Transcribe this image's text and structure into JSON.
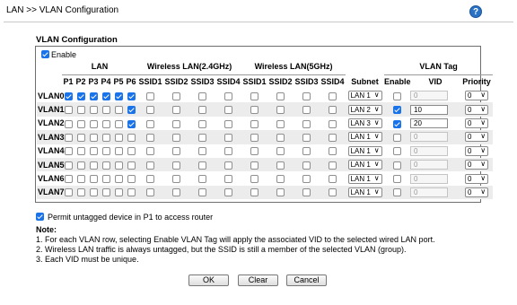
{
  "header": {
    "title": "LAN >> VLAN Configuration",
    "help_icon": "?"
  },
  "section_title": "VLAN Configuration",
  "enable": {
    "label": "Enable",
    "checked": true
  },
  "groups": {
    "lan": "LAN",
    "wlan24": "Wireless LAN(2.4GHz)",
    "wlan5": "Wireless LAN(5GHz)",
    "vlan_tag": "VLAN Tag"
  },
  "columns": {
    "lan": [
      "P1",
      "P2",
      "P3",
      "P4",
      "P5",
      "P6"
    ],
    "wlan24": [
      "SSID1",
      "SSID2",
      "SSID3",
      "SSID4"
    ],
    "wlan5": [
      "SSID1",
      "SSID2",
      "SSID3",
      "SSID4"
    ],
    "subnet": "Subnet",
    "enable": "Enable",
    "vid": "VID",
    "priority": "Priority"
  },
  "rows": [
    {
      "name": "VLAN0",
      "lan": [
        true,
        true,
        true,
        true,
        true,
        true
      ],
      "wlan24": [
        false,
        false,
        false,
        false
      ],
      "wlan5": [
        false,
        false,
        false,
        false
      ],
      "subnet": "LAN 1",
      "tag_enable": false,
      "vid": "0",
      "priority": "0"
    },
    {
      "name": "VLAN1",
      "lan": [
        false,
        false,
        false,
        false,
        false,
        true
      ],
      "wlan24": [
        false,
        false,
        false,
        false
      ],
      "wlan5": [
        false,
        false,
        false,
        false
      ],
      "subnet": "LAN 2",
      "tag_enable": true,
      "vid": "10",
      "priority": "0"
    },
    {
      "name": "VLAN2",
      "lan": [
        false,
        false,
        false,
        false,
        false,
        true
      ],
      "wlan24": [
        false,
        false,
        false,
        false
      ],
      "wlan5": [
        false,
        false,
        false,
        false
      ],
      "subnet": "LAN 3",
      "tag_enable": true,
      "vid": "20",
      "priority": "0"
    },
    {
      "name": "VLAN3",
      "lan": [
        false,
        false,
        false,
        false,
        false,
        false
      ],
      "wlan24": [
        false,
        false,
        false,
        false
      ],
      "wlan5": [
        false,
        false,
        false,
        false
      ],
      "subnet": "LAN 1",
      "tag_enable": false,
      "vid": "0",
      "priority": "0"
    },
    {
      "name": "VLAN4",
      "lan": [
        false,
        false,
        false,
        false,
        false,
        false
      ],
      "wlan24": [
        false,
        false,
        false,
        false
      ],
      "wlan5": [
        false,
        false,
        false,
        false
      ],
      "subnet": "LAN 1",
      "tag_enable": false,
      "vid": "0",
      "priority": "0"
    },
    {
      "name": "VLAN5",
      "lan": [
        false,
        false,
        false,
        false,
        false,
        false
      ],
      "wlan24": [
        false,
        false,
        false,
        false
      ],
      "wlan5": [
        false,
        false,
        false,
        false
      ],
      "subnet": "LAN 1",
      "tag_enable": false,
      "vid": "0",
      "priority": "0"
    },
    {
      "name": "VLAN6",
      "lan": [
        false,
        false,
        false,
        false,
        false,
        false
      ],
      "wlan24": [
        false,
        false,
        false,
        false
      ],
      "wlan5": [
        false,
        false,
        false,
        false
      ],
      "subnet": "LAN 1",
      "tag_enable": false,
      "vid": "0",
      "priority": "0"
    },
    {
      "name": "VLAN7",
      "lan": [
        false,
        false,
        false,
        false,
        false,
        false
      ],
      "wlan24": [
        false,
        false,
        false,
        false
      ],
      "wlan5": [
        false,
        false,
        false,
        false
      ],
      "subnet": "LAN 1",
      "tag_enable": false,
      "vid": "0",
      "priority": "0"
    }
  ],
  "permit_untagged": {
    "label": "Permit untagged device in P1 to access router",
    "checked": true
  },
  "note": {
    "title": "Note:",
    "items": [
      "1. For each VLAN row, selecting Enable VLAN Tag will apply the associated VID to the selected wired LAN port.",
      "2. Wireless LAN traffic is always untagged, but the SSID is still a member of the selected VLAN (group).",
      "3. Each VID must be unique."
    ]
  },
  "buttons": {
    "ok": "OK",
    "clear": "Clear",
    "cancel": "Cancel"
  },
  "colors": {
    "checkbox_checked": "#1a73e8",
    "help_icon": "#2a72c4",
    "row_alt": "#ececec"
  },
  "icons": {
    "help": "help-question-icon",
    "dropdown": "chevron-down-icon",
    "checkbox": "checkbox-icon"
  }
}
